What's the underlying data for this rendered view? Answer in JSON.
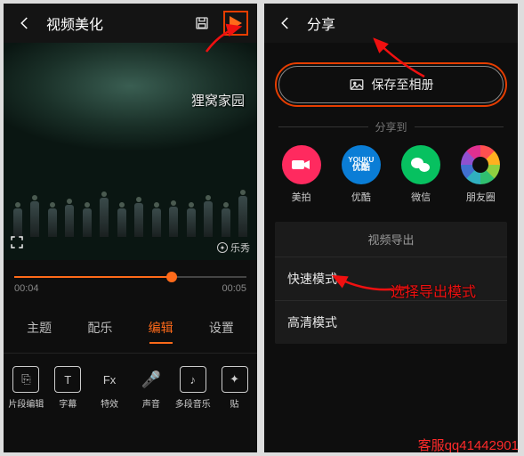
{
  "left": {
    "header": {
      "title": "视频美化"
    },
    "video": {
      "watermark": "狸窝家园",
      "brand": "乐秀"
    },
    "timeline": {
      "start": "00:04",
      "end": "00:05"
    },
    "tabs": [
      "主题",
      "配乐",
      "编辑",
      "设置"
    ],
    "active_tab_index": 2,
    "tools": [
      {
        "label": "片段编辑",
        "glyph": "⎘"
      },
      {
        "label": "字幕",
        "glyph": "T"
      },
      {
        "label": "特效",
        "glyph": "Fx"
      },
      {
        "label": "声音",
        "glyph": "🎤"
      },
      {
        "label": "多段音乐",
        "glyph": "♪"
      },
      {
        "label": "贴",
        "glyph": "✦"
      }
    ]
  },
  "right": {
    "header": {
      "title": "分享"
    },
    "save_button": "保存至相册",
    "share_to_label": "分享到",
    "share_targets": [
      {
        "name": "美拍",
        "id": "meipai"
      },
      {
        "name": "优酷",
        "id": "youku"
      },
      {
        "name": "微信",
        "id": "wechat"
      },
      {
        "name": "朋友圈",
        "id": "moments"
      }
    ],
    "youku_text_top": "YOUKU",
    "youku_text_bottom": "优酷",
    "export": {
      "title": "视频导出",
      "options": [
        "快速模式",
        "高清模式"
      ]
    }
  },
  "annotations": {
    "choose_mode": "选择导出模式",
    "support": "客服qq41442901"
  }
}
